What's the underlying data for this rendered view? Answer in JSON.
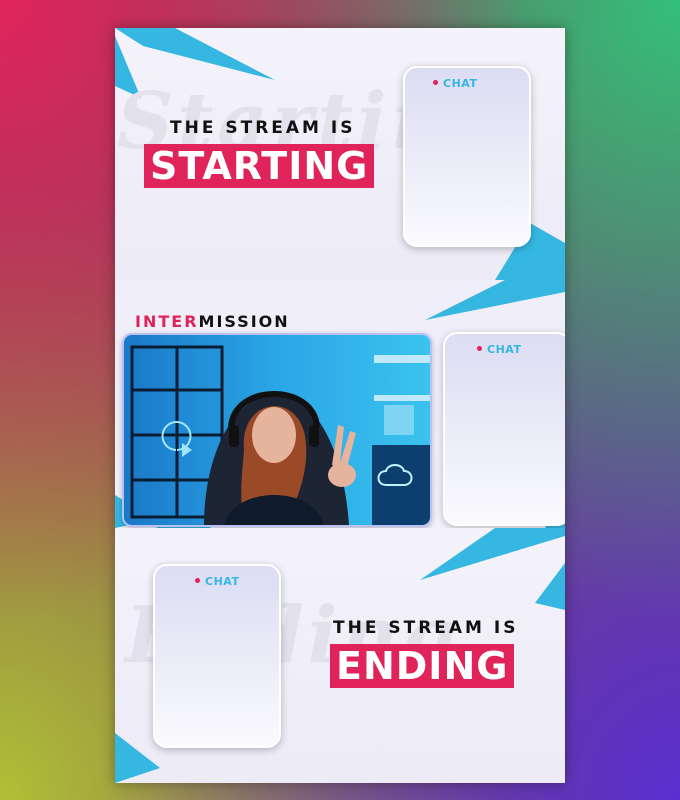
{
  "panels": {
    "starting": {
      "title_small": "THE STREAM IS",
      "title_big": "STARTING",
      "chat_label": "CHAT",
      "ghost_text": "Starting"
    },
    "intermission": {
      "title_part1": "INTER",
      "title_part2": "MISSION",
      "chat_label": "CHAT",
      "webcam": "webcam-preview"
    },
    "ending": {
      "title_small": "THE STREAM IS",
      "title_big": "ENDING",
      "chat_label": "CHAT",
      "ghost_text": "Ending"
    }
  },
  "colors": {
    "accent_pink": "#e0245a",
    "accent_blue": "#35b7e1",
    "panel_bg": "#f1f0f8",
    "text_dark": "#111111"
  }
}
